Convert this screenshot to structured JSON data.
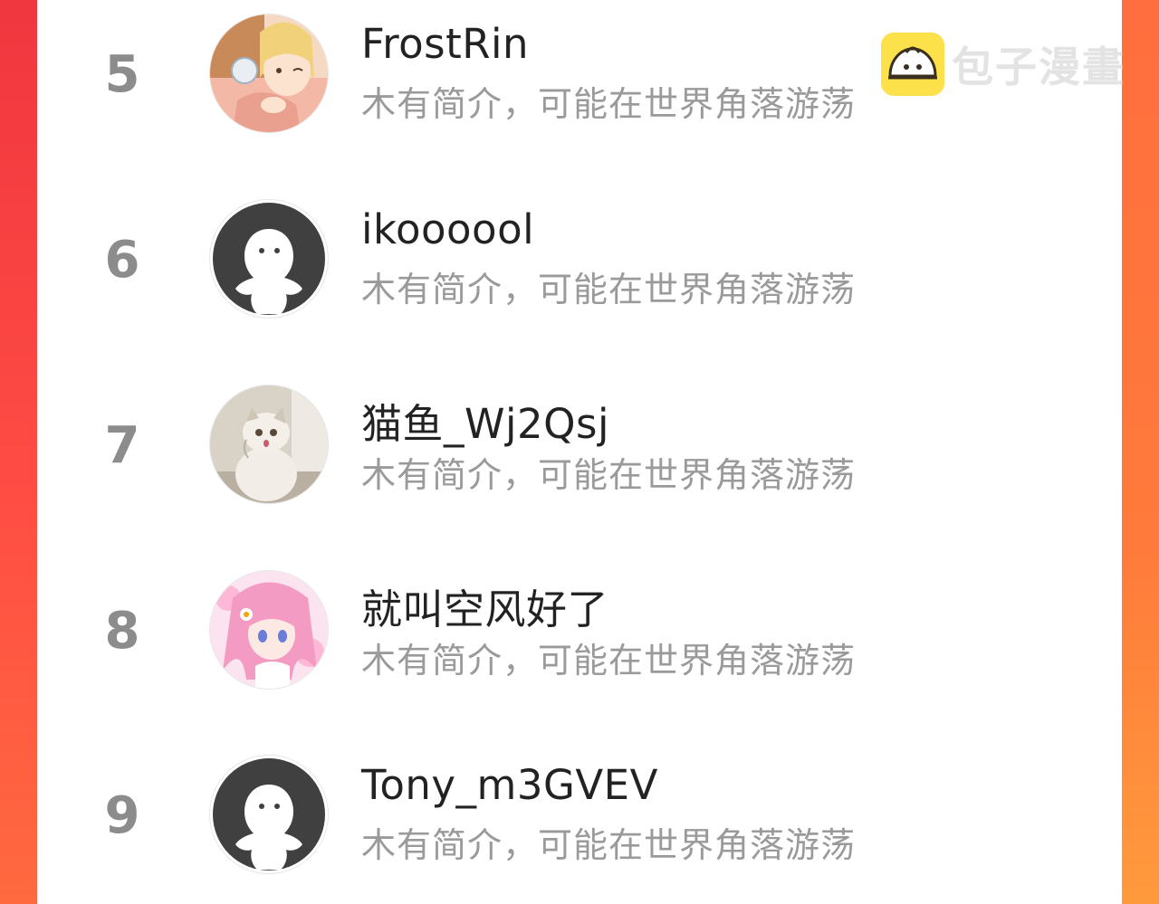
{
  "watermark": {
    "brand": "包子漫畫",
    "logo_icon": "steamed-bun-icon",
    "accent": "#fde14a"
  },
  "users": [
    {
      "rank": "5",
      "name": "FrostRin",
      "bio": "木有简介，可能在世界角落游荡",
      "avatar": "anime-boy-avatar"
    },
    {
      "rank": "6",
      "name": "ikoooool",
      "bio": "木有简介，可能在世界角落游荡",
      "avatar": "default-avatar"
    },
    {
      "rank": "7",
      "name": "猫鱼_Wj2Qsj",
      "bio": "木有简介，可能在世界角落游荡",
      "avatar": "cat-avatar"
    },
    {
      "rank": "8",
      "name": "就叫空风好了",
      "bio": "木有简介，可能在世界角落游荡",
      "avatar": "anime-girl-avatar"
    },
    {
      "rank": "9",
      "name": "Tony_m3GVEV",
      "bio": "木有简介，可能在世界角落游荡",
      "avatar": "default-avatar"
    }
  ]
}
